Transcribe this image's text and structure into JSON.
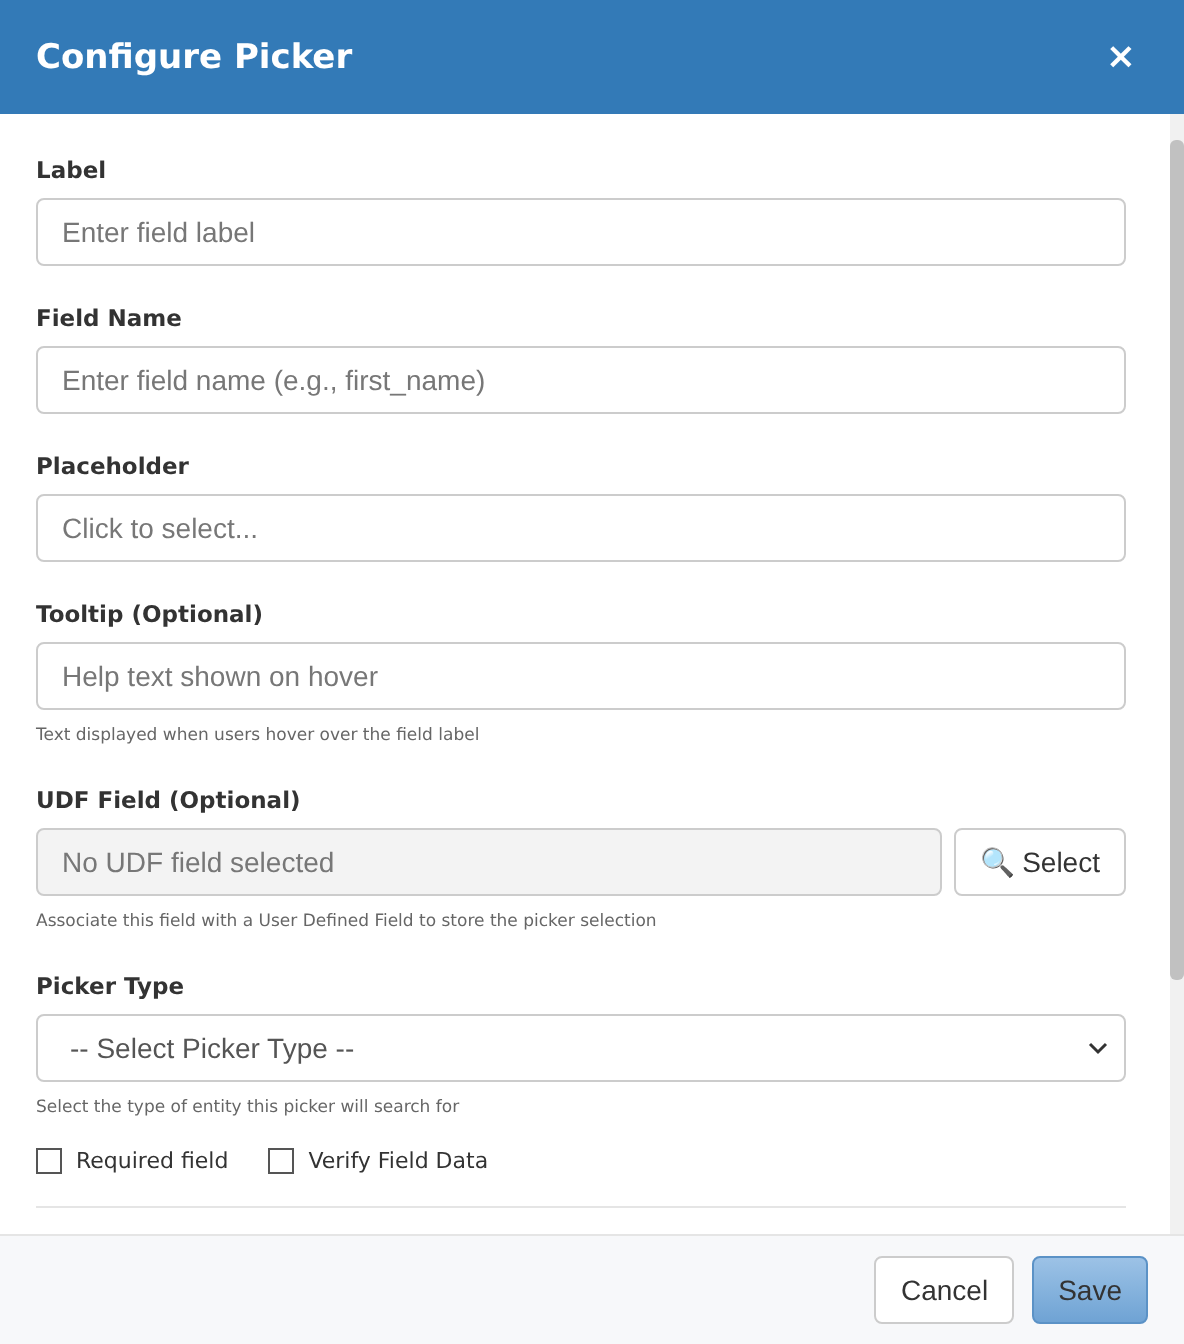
{
  "dialog": {
    "title": "Configure Picker",
    "close": "×"
  },
  "fields": [
    {
      "kind": "text",
      "label": "Label",
      "placeholder": "Enter field label"
    },
    {
      "kind": "text",
      "label": "Field Name",
      "placeholder": "Enter field name (e.g., first_name)"
    },
    {
      "kind": "text",
      "label": "Placeholder",
      "placeholder": "Click to select..."
    },
    {
      "kind": "text",
      "label": "Tooltip (Optional)",
      "placeholder": "Help text shown on hover",
      "help": "Text displayed when users hover over the field label"
    },
    {
      "kind": "udf",
      "label": "UDF Field (Optional)",
      "placeholder": "No UDF field selected",
      "button": "🔍 Select",
      "help": "Associate this field with a User Defined Field to store the picker selection"
    },
    {
      "kind": "select",
      "label": "Picker Type",
      "value": "-- Select Picker Type --",
      "help": "Select the type of entity this picker will search for"
    }
  ],
  "checkboxes": [
    {
      "label": "Required field",
      "checked": false
    },
    {
      "label": "Verify Field Data",
      "checked": false
    }
  ],
  "buttons": [
    {
      "label": "Cancel",
      "kind": "default"
    },
    {
      "label": "Save",
      "kind": "primary"
    }
  ]
}
